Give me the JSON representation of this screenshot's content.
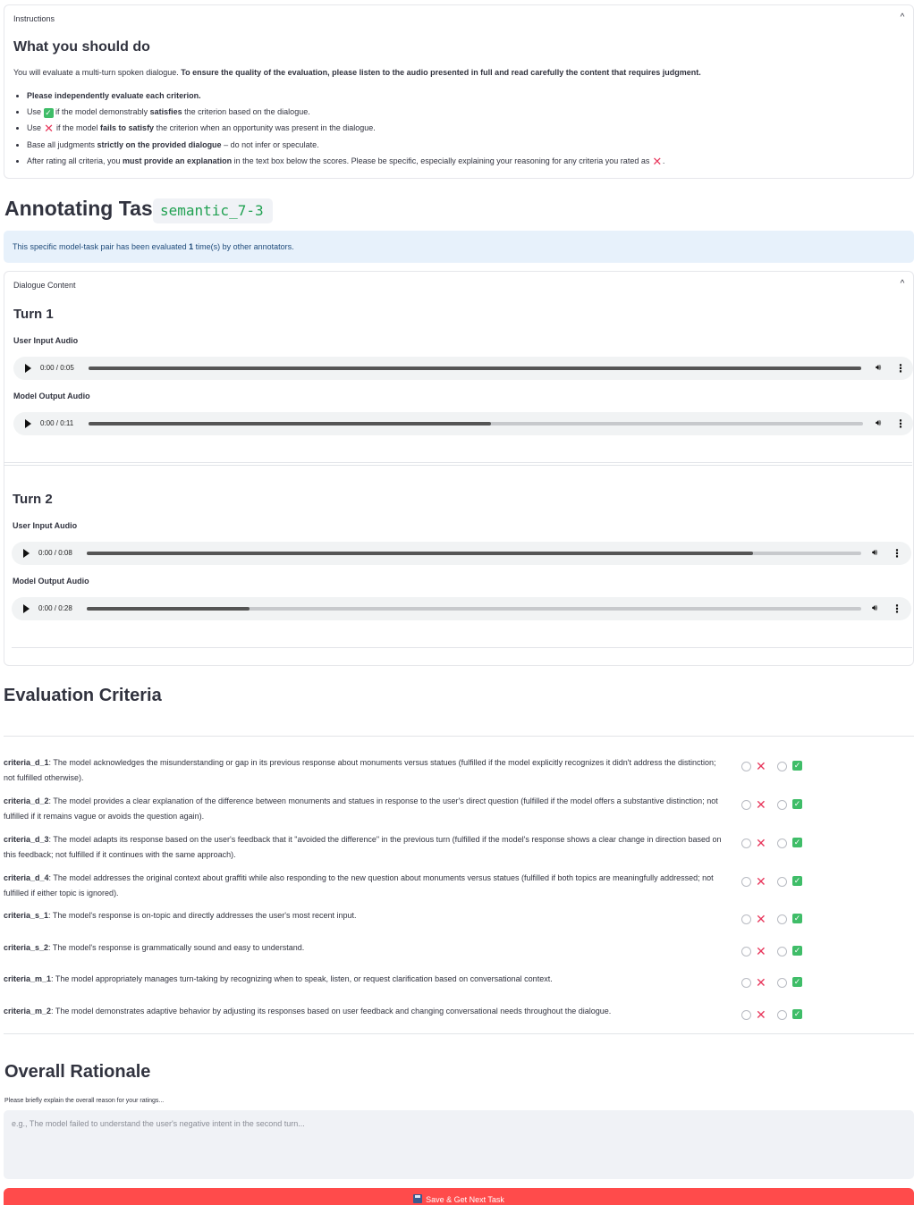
{
  "instructions": {
    "header": "Instructions",
    "title": "What you should do",
    "intro_plain": "You will evaluate a multi-turn spoken dialogue. ",
    "intro_bold": "To ensure the quality of the evaluation, please listen to the audio presented in full and read carefully the content that requires judgment.",
    "bullet1": "Please independently evaluate each criterion.",
    "bullet2_a": "Use ",
    "bullet2_b": " if the model demonstrably ",
    "bullet2_bold": "satisfies",
    "bullet2_c": " the criterion based on the dialogue.",
    "bullet3_a": "Use ",
    "bullet3_b": " if the model ",
    "bullet3_bold": "fails to satisfy",
    "bullet3_c": " the criterion when an opportunity was present in the dialogue.",
    "bullet4_a": "Base all judgments ",
    "bullet4_bold": "strictly on the provided dialogue",
    "bullet4_c": " – do not infer or speculate.",
    "bullet5_a": "After rating all criteria, you ",
    "bullet5_bold": "must provide an explanation",
    "bullet5_c": " in the text box below the scores. Please be specific, especially explaining your reasoning for any criteria you rated as ",
    "bullet5_d": "."
  },
  "task": {
    "label": "Annotating Task:",
    "code": "semantic_7-3",
    "info_a": "This specific model-task pair has been evaluated ",
    "info_count": "1",
    "info_b": " time(s) by other annotators."
  },
  "dialogue": {
    "header": "Dialogue Content",
    "turns": [
      {
        "title": "Turn 1",
        "user_label": "User Input Audio",
        "user_time": "0:00 / 0:05",
        "user_progress": 1.0,
        "model_label": "Model Output Audio",
        "model_time": "0:00 / 0:11",
        "model_progress": 0.52
      },
      {
        "title": "Turn 2",
        "user_label": "User Input Audio",
        "user_time": "0:00 / 0:08",
        "user_progress": 0.86,
        "model_label": "Model Output Audio",
        "model_time": "0:00 / 0:28",
        "model_progress": 0.21
      }
    ]
  },
  "evaluation": {
    "title": "Evaluation Criteria",
    "criteria": [
      {
        "id": "criteria_d_1",
        "text": ": The model acknowledges the misunderstanding or gap in its previous response about monuments versus statues (fulfilled if the model explicitly recognizes it didn't address the distinction; not fulfilled otherwise)."
      },
      {
        "id": "criteria_d_2",
        "text": ": The model provides a clear explanation of the difference between monuments and statues in response to the user's direct question (fulfilled if the model offers a substantive distinction; not fulfilled if it remains vague or avoids the question again)."
      },
      {
        "id": "criteria_d_3",
        "text": ": The model adapts its response based on the user's feedback that it \"avoided the difference\" in the previous turn (fulfilled if the model's response shows a clear change in direction based on this feedback; not fulfilled if it continues with the same approach)."
      },
      {
        "id": "criteria_d_4",
        "text": ": The model addresses the original context about graffiti while also responding to the new question about monuments versus statues (fulfilled if both topics are meaningfully addressed; not fulfilled if either topic is ignored)."
      },
      {
        "id": "criteria_s_1",
        "text": ": The model's response is on-topic and directly addresses the user's most recent input."
      },
      {
        "id": "criteria_s_2",
        "text": ": The model's response is grammatically sound and easy to understand."
      },
      {
        "id": "criteria_m_1",
        "text": ": The model appropriately manages turn-taking by recognizing when to speak, listen, or request clarification based on conversational context."
      },
      {
        "id": "criteria_m_2",
        "text": ": The model demonstrates adaptive behavior by adjusting its responses based on user feedback and changing conversational needs throughout the dialogue."
      }
    ],
    "glyph_x": "✕",
    "glyph_check": "✓"
  },
  "rationale": {
    "title": "Overall Rationale",
    "label": "Please briefly explain the overall reason for your ratings...",
    "placeholder": "e.g., The model failed to understand the user's negative intent in the second turn..."
  },
  "submit": {
    "label": "Save & Get Next Task"
  },
  "colors": {
    "accent_red": "#ff4b4b",
    "x_red": "#e8375c",
    "check_green": "#3fbd68",
    "code_green": "#21a152",
    "info_bg": "#e7f1fb"
  }
}
